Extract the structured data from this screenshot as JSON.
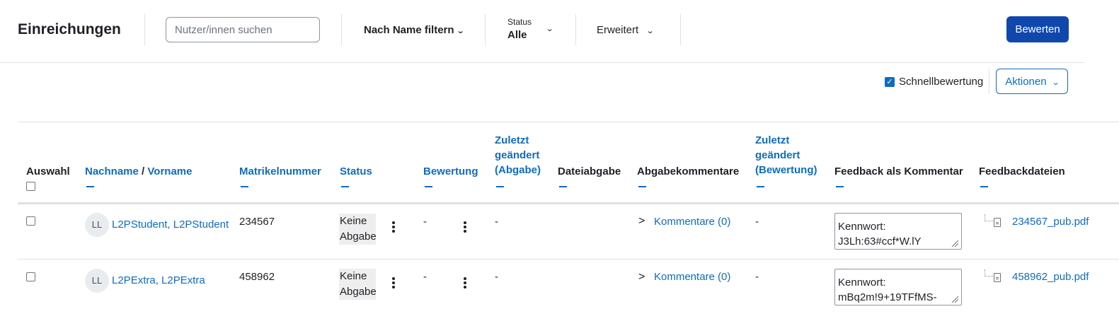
{
  "header": {
    "title": "Einreichungen",
    "search_placeholder": "Nutzer/innen suchen",
    "filter_name_label": "Nach Name filtern",
    "status_label": "Status",
    "status_value": "Alle",
    "advanced_label": "Erweitert",
    "grade_button": "Bewerten"
  },
  "toolbar": {
    "quick_grading_label": "Schnellbewertung",
    "quick_grading_checked": true,
    "actions_label": "Aktionen"
  },
  "table": {
    "headers": {
      "select": "Auswahl",
      "lastname": "Nachname",
      "separator": "/",
      "firstname": "Vorname",
      "idnumber": "Matrikelnummer",
      "status": "Status",
      "grade": "Bewertung",
      "modified_submission_1": "Zuletzt",
      "modified_submission_2": "geändert",
      "modified_submission_3": "(Abgabe)",
      "file_submission": "Dateiabgabe",
      "submission_comments": "Abgabekommentare",
      "modified_grade_1": "Zuletzt",
      "modified_grade_2": "geändert",
      "modified_grade_3": "(Bewertung)",
      "feedback_comments": "Feedback als Kommentar",
      "feedback_files": "Feedbackdateien"
    },
    "rows": [
      {
        "initials": "LL",
        "name": "L2PStudent, L2PStudent",
        "idnumber": "234567",
        "status_line1": "Keine",
        "status_line2": "Abgabe",
        "grade": "-",
        "modified_submission": "-",
        "comments": "Kommentare (0)",
        "modified_grade": "-",
        "feedback": "Kennwort: J3Lh:63#ccf*W.lY",
        "file": "234567_pub.pdf"
      },
      {
        "initials": "LL",
        "name": "L2PExtra, L2PExtra",
        "idnumber": "458962",
        "status_line1": "Keine",
        "status_line2": "Abgabe",
        "grade": "-",
        "modified_submission": "-",
        "comments": "Kommentare (0)",
        "modified_grade": "-",
        "feedback": "Kennwort: mBq2m!9+19TFfMS-",
        "file": "458962_pub.pdf"
      }
    ]
  }
}
